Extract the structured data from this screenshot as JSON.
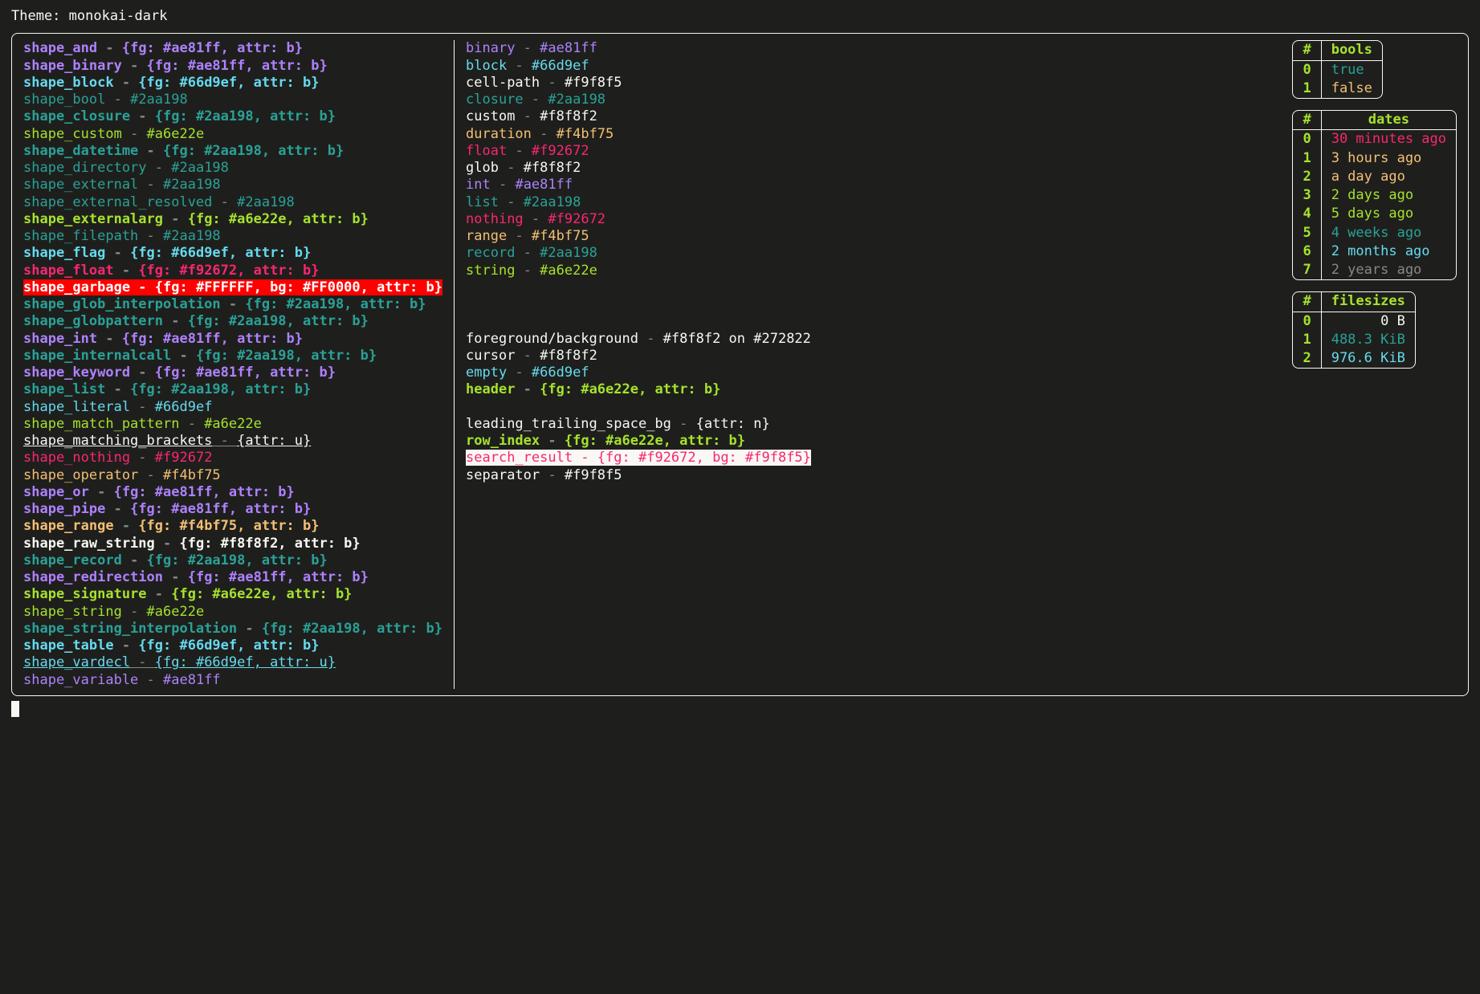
{
  "theme_label": "Theme: monokai-dark",
  "separator": " - ",
  "colors": {
    "purple": "#ae81ff",
    "cyan": "#66d9ef",
    "teal": "#2aa198",
    "green": "#a6e22e",
    "yellow": "#f4bf75",
    "pink": "#f92672",
    "white": "#f8f8f2",
    "offwhite": "#f9f8f5",
    "red_bg": "#FF0000",
    "fg_white": "#FFFFFF",
    "dim": "#888888"
  },
  "shapes": [
    {
      "name": "shape_and",
      "val": "{fg: #ae81ff, attr: b}",
      "fg": "#ae81ff",
      "bold": true
    },
    {
      "name": "shape_binary",
      "val": "{fg: #ae81ff, attr: b}",
      "fg": "#ae81ff",
      "bold": true
    },
    {
      "name": "shape_block",
      "val": "{fg: #66d9ef, attr: b}",
      "fg": "#66d9ef",
      "bold": true
    },
    {
      "name": "shape_bool",
      "val": "#2aa198",
      "fg": "#2aa198"
    },
    {
      "name": "shape_closure",
      "val": "{fg: #2aa198, attr: b}",
      "fg": "#2aa198",
      "bold": true
    },
    {
      "name": "shape_custom",
      "val": "#a6e22e",
      "fg": "#a6e22e"
    },
    {
      "name": "shape_datetime",
      "val": "{fg: #2aa198, attr: b}",
      "fg": "#2aa198",
      "bold": true
    },
    {
      "name": "shape_directory",
      "val": "#2aa198",
      "fg": "#2aa198"
    },
    {
      "name": "shape_external",
      "val": "#2aa198",
      "fg": "#2aa198"
    },
    {
      "name": "shape_external_resolved",
      "val": "#2aa198",
      "fg": "#2aa198"
    },
    {
      "name": "shape_externalarg",
      "val": "{fg: #a6e22e, attr: b}",
      "fg": "#a6e22e",
      "bold": true
    },
    {
      "name": "shape_filepath",
      "val": "#2aa198",
      "fg": "#2aa198"
    },
    {
      "name": "shape_flag",
      "val": "{fg: #66d9ef, attr: b}",
      "fg": "#66d9ef",
      "bold": true
    },
    {
      "name": "shape_float",
      "val": "{fg: #f92672, attr: b}",
      "fg": "#f92672",
      "bold": true
    },
    {
      "name": "shape_garbage",
      "val": "{fg: #FFFFFF, bg: #FF0000, attr: b}",
      "fg": "#FFFFFF",
      "bg": "#FF0000",
      "bold": true
    },
    {
      "name": "shape_glob_interpolation",
      "val": "{fg: #2aa198, attr: b}",
      "fg": "#2aa198",
      "bold": true
    },
    {
      "name": "shape_globpattern",
      "val": "{fg: #2aa198, attr: b}",
      "fg": "#2aa198",
      "bold": true
    },
    {
      "name": "shape_int",
      "val": "{fg: #ae81ff, attr: b}",
      "fg": "#ae81ff",
      "bold": true
    },
    {
      "name": "shape_internalcall",
      "val": "{fg: #2aa198, attr: b}",
      "fg": "#2aa198",
      "bold": true
    },
    {
      "name": "shape_keyword",
      "val": "{fg: #ae81ff, attr: b}",
      "fg": "#ae81ff",
      "bold": true
    },
    {
      "name": "shape_list",
      "val": "{fg: #2aa198, attr: b}",
      "fg": "#2aa198",
      "bold": true
    },
    {
      "name": "shape_literal",
      "val": "#66d9ef",
      "fg": "#66d9ef"
    },
    {
      "name": "shape_match_pattern",
      "val": "#a6e22e",
      "fg": "#a6e22e"
    },
    {
      "name": "shape_matching_brackets",
      "val": "{attr: u}",
      "fg": "#f8f8f2",
      "under": true
    },
    {
      "name": "shape_nothing",
      "val": "#f92672",
      "fg": "#f92672"
    },
    {
      "name": "shape_operator",
      "val": "#f4bf75",
      "fg": "#f4bf75"
    },
    {
      "name": "shape_or",
      "val": "{fg: #ae81ff, attr: b}",
      "fg": "#ae81ff",
      "bold": true
    },
    {
      "name": "shape_pipe",
      "val": "{fg: #ae81ff, attr: b}",
      "fg": "#ae81ff",
      "bold": true
    },
    {
      "name": "shape_range",
      "val": "{fg: #f4bf75, attr: b}",
      "fg": "#f4bf75",
      "bold": true
    },
    {
      "name": "shape_raw_string",
      "val": "{fg: #f8f8f2, attr: b}",
      "fg": "#f8f8f2",
      "bold": true
    },
    {
      "name": "shape_record",
      "val": "{fg: #2aa198, attr: b}",
      "fg": "#2aa198",
      "bold": true
    },
    {
      "name": "shape_redirection",
      "val": "{fg: #ae81ff, attr: b}",
      "fg": "#ae81ff",
      "bold": true
    },
    {
      "name": "shape_signature",
      "val": "{fg: #a6e22e, attr: b}",
      "fg": "#a6e22e",
      "bold": true
    },
    {
      "name": "shape_string",
      "val": "#a6e22e",
      "fg": "#a6e22e"
    },
    {
      "name": "shape_string_interpolation",
      "val": "{fg: #2aa198, attr: b}",
      "fg": "#2aa198",
      "bold": true
    },
    {
      "name": "shape_table",
      "val": "{fg: #66d9ef, attr: b}",
      "fg": "#66d9ef",
      "bold": true
    },
    {
      "name": "shape_vardecl",
      "val": "{fg: #66d9ef, attr: u}",
      "fg": "#66d9ef",
      "under": true
    },
    {
      "name": "shape_variable",
      "val": "#ae81ff",
      "fg": "#ae81ff"
    }
  ],
  "types": [
    {
      "name": "binary",
      "val": "#ae81ff",
      "fg": "#ae81ff"
    },
    {
      "name": "block",
      "val": "#66d9ef",
      "fg": "#66d9ef"
    },
    {
      "name": "cell-path",
      "val": "#f9f8f5",
      "fg": "#f9f8f5"
    },
    {
      "name": "closure",
      "val": "#2aa198",
      "fg": "#2aa198"
    },
    {
      "name": "custom",
      "val": "#f8f8f2",
      "fg": "#f8f8f2"
    },
    {
      "name": "duration",
      "val": "#f4bf75",
      "fg": "#f4bf75"
    },
    {
      "name": "float",
      "val": "#f92672",
      "fg": "#f92672"
    },
    {
      "name": "glob",
      "val": "#f8f8f2",
      "fg": "#f8f8f2"
    },
    {
      "name": "int",
      "val": "#ae81ff",
      "fg": "#ae81ff"
    },
    {
      "name": "list",
      "val": "#2aa198",
      "fg": "#2aa198"
    },
    {
      "name": "nothing",
      "val": "#f92672",
      "fg": "#f92672"
    },
    {
      "name": "range",
      "val": "#f4bf75",
      "fg": "#f4bf75"
    },
    {
      "name": "record",
      "val": "#2aa198",
      "fg": "#2aa198"
    },
    {
      "name": "string",
      "val": "#a6e22e",
      "fg": "#a6e22e"
    }
  ],
  "misc": [
    {
      "name": "foreground/background",
      "val": "#f8f8f2 on #272822",
      "fg": "#f8f8f2"
    },
    {
      "name": "cursor",
      "val": "#f8f8f2",
      "fg": "#f8f8f2"
    },
    {
      "name": "empty",
      "val": "#66d9ef",
      "fg": "#66d9ef"
    },
    {
      "name": "header",
      "val": "{fg: #a6e22e, attr: b}",
      "fg": "#a6e22e",
      "bold": true
    }
  ],
  "misc2": [
    {
      "name": "leading_trailing_space_bg",
      "val": "{attr: n}",
      "fg": "#f8f8f2"
    },
    {
      "name": "row_index",
      "val": "{fg: #a6e22e, attr: b}",
      "fg": "#a6e22e",
      "bold": true
    },
    {
      "name": "search_result",
      "val": "{fg: #f92672, bg: #f9f8f5}",
      "fg": "#f92672",
      "bg": "#f9f8f5"
    },
    {
      "name": "separator",
      "val": "#f9f8f5",
      "fg": "#f9f8f5"
    }
  ],
  "tables": {
    "bools": {
      "title": "bools",
      "rows": [
        {
          "idx": "0",
          "val": "true",
          "fg": "#2aa198"
        },
        {
          "idx": "1",
          "val": "false",
          "fg": "#f4bf75"
        }
      ]
    },
    "dates": {
      "title": "dates",
      "rows": [
        {
          "idx": "0",
          "val": "30 minutes ago",
          "fg": "#f92672"
        },
        {
          "idx": "1",
          "val": "3 hours ago",
          "fg": "#f4bf75"
        },
        {
          "idx": "2",
          "val": "a day ago",
          "fg": "#f4bf75"
        },
        {
          "idx": "3",
          "val": "2 days ago",
          "fg": "#a6e22e"
        },
        {
          "idx": "4",
          "val": "5 days ago",
          "fg": "#a6e22e"
        },
        {
          "idx": "5",
          "val": "4 weeks ago",
          "fg": "#2aa198"
        },
        {
          "idx": "6",
          "val": "2 months ago",
          "fg": "#66d9ef"
        },
        {
          "idx": "7",
          "val": "2 years ago",
          "fg": "#888888"
        }
      ]
    },
    "filesizes": {
      "title": "filesizes",
      "rows": [
        {
          "idx": "0",
          "val": "0 B",
          "fg": "#f8f8f2",
          "align": "right"
        },
        {
          "idx": "1",
          "val": "488.3 KiB",
          "fg": "#2aa198"
        },
        {
          "idx": "2",
          "val": "976.6 KiB",
          "fg": "#66d9ef"
        }
      ]
    }
  },
  "hash_header": "#"
}
